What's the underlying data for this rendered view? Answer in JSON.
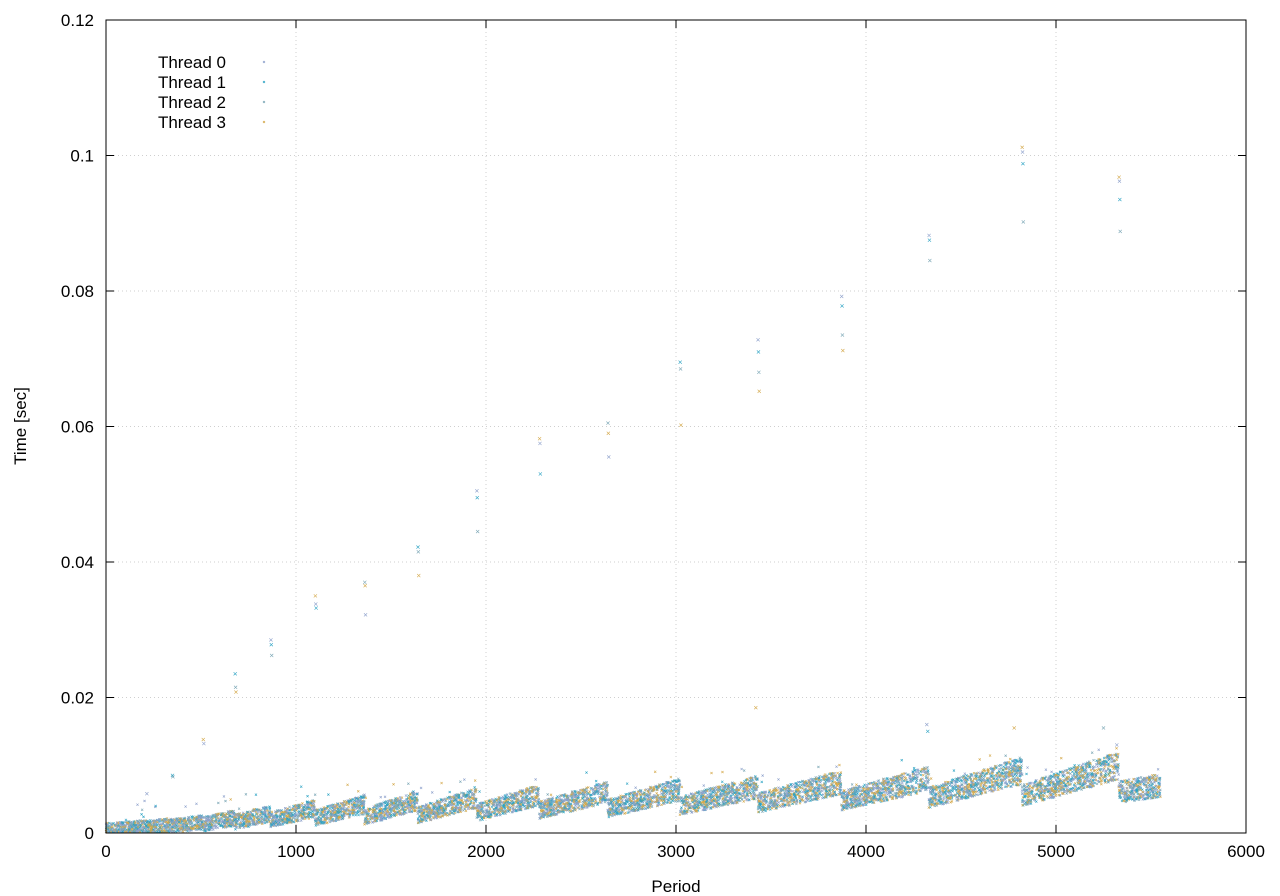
{
  "chart_data": {
    "type": "scatter",
    "title": "",
    "xlabel": "Period",
    "ylabel": "Time [sec]",
    "xlim": [
      0,
      6000
    ],
    "ylim": [
      0,
      0.12
    ],
    "x_ticks": [
      "0",
      "1000",
      "2000",
      "3000",
      "4000",
      "5000",
      "6000"
    ],
    "x_tick_values": [
      0,
      1000,
      2000,
      3000,
      4000,
      5000,
      6000
    ],
    "y_ticks": [
      "0",
      "0.02",
      "0.04",
      "0.06",
      "0.08",
      "0.1",
      "0.12"
    ],
    "y_tick_values": [
      0,
      0.02,
      0.04,
      0.06,
      0.08,
      0.1,
      0.12
    ],
    "grid": true,
    "legend_position": "top-left",
    "series": [
      {
        "name": "Thread 0",
        "color": "#8da0cb"
      },
      {
        "name": "Thread 1",
        "color": "#2ca3c4"
      },
      {
        "name": "Thread 2",
        "color": "#7aa6b5"
      },
      {
        "name": "Thread 3",
        "color": "#d4a84a"
      }
    ],
    "segments": [
      {
        "x_start": 0,
        "x_end": 210,
        "y_start": 0.0005,
        "y_end": 0.0009
      },
      {
        "x_start": 210,
        "x_end": 345,
        "y_start": 0.0008,
        "y_end": 0.0012
      },
      {
        "x_start": 345,
        "x_end": 510,
        "y_start": 0.001,
        "y_end": 0.0016
      },
      {
        "x_start": 510,
        "x_end": 675,
        "y_start": 0.0013,
        "y_end": 0.0022
      },
      {
        "x_start": 675,
        "x_end": 865,
        "y_start": 0.0016,
        "y_end": 0.0028
      },
      {
        "x_start": 865,
        "x_end": 1100,
        "y_start": 0.002,
        "y_end": 0.0036
      },
      {
        "x_start": 1100,
        "x_end": 1360,
        "y_start": 0.0022,
        "y_end": 0.0042
      },
      {
        "x_start": 1360,
        "x_end": 1640,
        "y_start": 0.0024,
        "y_end": 0.0048
      },
      {
        "x_start": 1640,
        "x_end": 1950,
        "y_start": 0.0026,
        "y_end": 0.0052
      },
      {
        "x_start": 1950,
        "x_end": 2280,
        "y_start": 0.003,
        "y_end": 0.0056
      },
      {
        "x_start": 2280,
        "x_end": 2640,
        "y_start": 0.0034,
        "y_end": 0.006
      },
      {
        "x_start": 2640,
        "x_end": 3020,
        "y_start": 0.0036,
        "y_end": 0.0064
      },
      {
        "x_start": 3020,
        "x_end": 3430,
        "y_start": 0.004,
        "y_end": 0.0068
      },
      {
        "x_start": 3430,
        "x_end": 3870,
        "y_start": 0.0044,
        "y_end": 0.0075
      },
      {
        "x_start": 3870,
        "x_end": 4330,
        "y_start": 0.0048,
        "y_end": 0.008
      },
      {
        "x_start": 4330,
        "x_end": 4820,
        "y_start": 0.0052,
        "y_end": 0.0092
      },
      {
        "x_start": 4820,
        "x_end": 5330,
        "y_start": 0.0055,
        "y_end": 0.01
      },
      {
        "x_start": 5330,
        "x_end": 5550,
        "y_start": 0.006,
        "y_end": 0.007
      }
    ],
    "outliers": [
      {
        "x": 215,
        "y": 0.0058
      },
      {
        "x": 350,
        "y": 0.0085
      },
      {
        "x": 352,
        "y": 0.0083
      },
      {
        "x": 512,
        "y": 0.0138
      },
      {
        "x": 515,
        "y": 0.0132
      },
      {
        "x": 680,
        "y": 0.0235
      },
      {
        "x": 682,
        "y": 0.0215
      },
      {
        "x": 684,
        "y": 0.0208
      },
      {
        "x": 868,
        "y": 0.0285
      },
      {
        "x": 870,
        "y": 0.0278
      },
      {
        "x": 872,
        "y": 0.0262
      },
      {
        "x": 1102,
        "y": 0.035
      },
      {
        "x": 1104,
        "y": 0.0338
      },
      {
        "x": 1106,
        "y": 0.0332
      },
      {
        "x": 1362,
        "y": 0.037
      },
      {
        "x": 1364,
        "y": 0.0365
      },
      {
        "x": 1366,
        "y": 0.0322
      },
      {
        "x": 1642,
        "y": 0.0422
      },
      {
        "x": 1644,
        "y": 0.0415
      },
      {
        "x": 1646,
        "y": 0.038
      },
      {
        "x": 1952,
        "y": 0.0505
      },
      {
        "x": 1954,
        "y": 0.0495
      },
      {
        "x": 1956,
        "y": 0.0445
      },
      {
        "x": 2282,
        "y": 0.0582
      },
      {
        "x": 2284,
        "y": 0.0575
      },
      {
        "x": 2286,
        "y": 0.053
      },
      {
        "x": 2642,
        "y": 0.0605
      },
      {
        "x": 2644,
        "y": 0.059
      },
      {
        "x": 2646,
        "y": 0.0555
      },
      {
        "x": 3022,
        "y": 0.0695
      },
      {
        "x": 3024,
        "y": 0.0685
      },
      {
        "x": 3026,
        "y": 0.0602
      },
      {
        "x": 3432,
        "y": 0.0728
      },
      {
        "x": 3434,
        "y": 0.071
      },
      {
        "x": 3436,
        "y": 0.068
      },
      {
        "x": 3438,
        "y": 0.0652
      },
      {
        "x": 3872,
        "y": 0.0792
      },
      {
        "x": 3874,
        "y": 0.0778
      },
      {
        "x": 3876,
        "y": 0.0735
      },
      {
        "x": 3878,
        "y": 0.0712
      },
      {
        "x": 4332,
        "y": 0.0882
      },
      {
        "x": 4334,
        "y": 0.0875
      },
      {
        "x": 4336,
        "y": 0.0845
      },
      {
        "x": 4822,
        "y": 0.1012
      },
      {
        "x": 4824,
        "y": 0.1005
      },
      {
        "x": 4826,
        "y": 0.0988
      },
      {
        "x": 4828,
        "y": 0.0902
      },
      {
        "x": 5332,
        "y": 0.0968
      },
      {
        "x": 5334,
        "y": 0.0962
      },
      {
        "x": 5336,
        "y": 0.0935
      },
      {
        "x": 5338,
        "y": 0.0888
      },
      {
        "x": 3420,
        "y": 0.0185
      },
      {
        "x": 4320,
        "y": 0.016
      },
      {
        "x": 4325,
        "y": 0.015
      },
      {
        "x": 5250,
        "y": 0.0155
      },
      {
        "x": 4780,
        "y": 0.0155
      },
      {
        "x": 5320,
        "y": 0.013
      }
    ]
  }
}
